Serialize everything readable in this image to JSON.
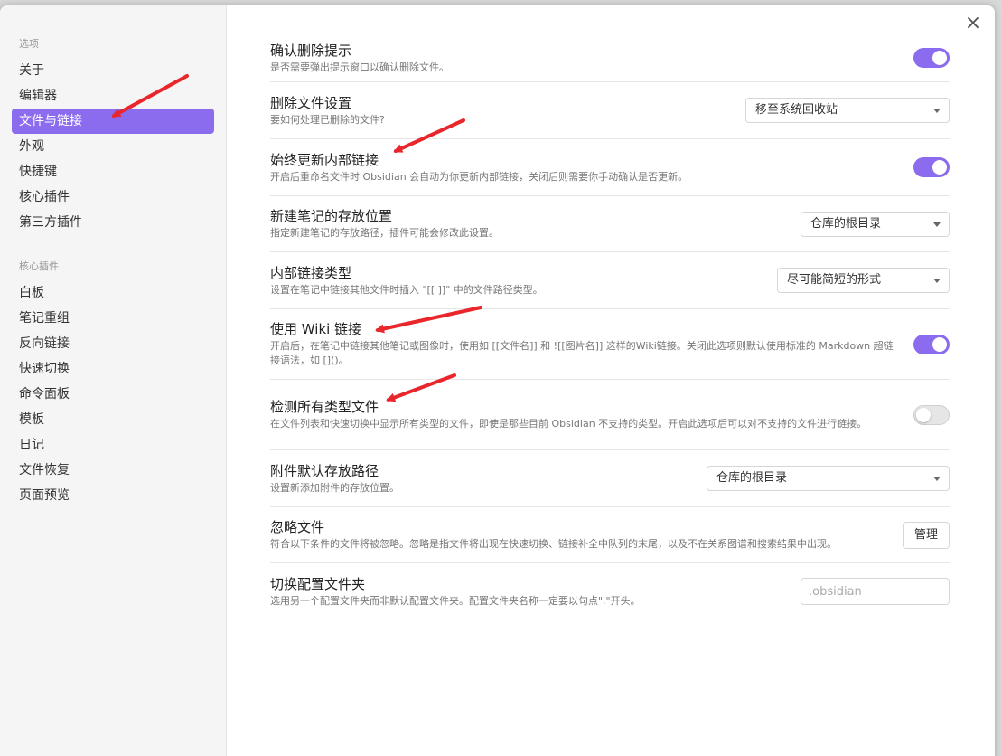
{
  "sidebar": {
    "group1": "选项",
    "options": [
      "关于",
      "编辑器",
      "文件与链接",
      "外观",
      "快捷键",
      "核心插件",
      "第三方插件"
    ],
    "group2": "核心插件",
    "plugins": [
      "白板",
      "笔记重组",
      "反向链接",
      "快速切换",
      "命令面板",
      "模板",
      "日记",
      "文件恢复",
      "页面预览"
    ]
  },
  "close_icon": "×",
  "settings": [
    {
      "name": "确认删除提示",
      "desc": "是否需要弹出提示窗口以确认删除文件。",
      "control": "toggle",
      "on": true
    },
    {
      "name": "删除文件设置",
      "desc": "要如何处理已删除的文件?",
      "control": "select",
      "value": "移至系统回收站"
    },
    {
      "name": "始终更新内部链接",
      "desc": "开启后重命名文件时 Obsidian 会自动为你更新内部链接，关闭后则需要你手动确认是否更新。",
      "control": "toggle",
      "on": true
    },
    {
      "name": "新建笔记的存放位置",
      "desc": "指定新建笔记的存放路径，插件可能会修改此设置。",
      "control": "select",
      "value": "仓库的根目录"
    },
    {
      "name": "内部链接类型",
      "desc": "设置在笔记中链接其他文件时插入 \"[[ ]]\" 中的文件路径类型。",
      "control": "select",
      "value": "尽可能简短的形式"
    },
    {
      "name": "使用 Wiki 链接",
      "desc": "开启后，在笔记中链接其他笔记或图像时，使用如 [[文件名]] 和 ![[图片名]] 这样的Wiki链接。关闭此选项则默认使用标准的 Markdown 超链接语法，如 []()。",
      "control": "toggle",
      "on": true
    },
    {
      "name": "检测所有类型文件",
      "desc": "在文件列表和快速切换中显示所有类型的文件，即使是那些目前 Obsidian 不支持的类型。开启此选项后可以对不支持的文件进行链接。",
      "control": "toggle",
      "on": false
    },
    {
      "name": "附件默认存放路径",
      "desc": "设置新添加附件的存放位置。",
      "control": "select",
      "value": "仓库的根目录"
    },
    {
      "name": "忽略文件",
      "desc": "符合以下条件的文件将被忽略。忽略是指文件将出现在快速切换、链接补全中队列的末尾，以及不在关系图谱和搜索结果中出现。",
      "control": "button",
      "value": "管理"
    },
    {
      "name": "切换配置文件夹",
      "desc": "选用另一个配置文件夹而非默认配置文件夹。配置文件夹名称一定要以句点\".\"开头。",
      "control": "input",
      "placeholder": ".obsidian"
    }
  ],
  "accent_color": "#8b6cef",
  "annotation_color": "#e8262b"
}
